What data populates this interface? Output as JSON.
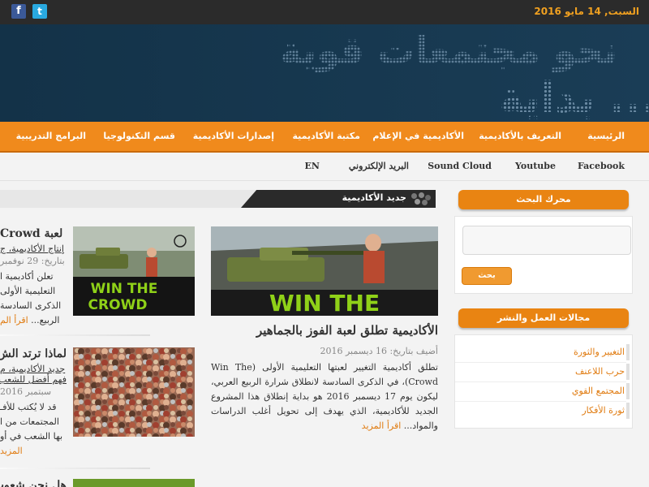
{
  "topbar": {
    "date": "السبت, 14 مايو 2016",
    "facebook_icon": "f",
    "twitter_icon": "t"
  },
  "banner": {
    "line1": "نحو مجتمعات قوية",
    "line2": "ثورة العقول... بداية"
  },
  "main_nav": {
    "items": [
      "الرئيسية",
      "التعريف بالأكاديمية",
      "الأكاديمية في الإعلام",
      "مكتبة الأكاديمية",
      "إصدارات الأكاديمية",
      "قسم التكنولوجيا",
      "البرامج التدريبية"
    ]
  },
  "sub_nav": {
    "items": [
      "Facebook",
      "Youtube",
      "Sound Cloud",
      "البريد الإلكتروني",
      "EN"
    ]
  },
  "section": {
    "title": "جديد الأكاديمية"
  },
  "featured": {
    "image_caption": "WIN THE",
    "title": "الأكاديمية تطلق لعبة الفوز بالجماهير",
    "meta": "أضيف بتاريخ: 16 ديسمبر 2016",
    "excerpt": "تطلق أكاديمية التغيير لعبتها التعليمية الأولى (Win The Crowd)، في الذكرى السادسة لانطلاق شرارة الربيع العربي، ليكون يوم 17 ديسمبر 2016 هو بداية إنطلاق هذا المشروع الجديد للأكاديمية، الذي يهدف إلى تحويل أغلب الدراسات والمواد...",
    "read_more": "اقرأ المزيد"
  },
  "articles": [
    {
      "image_caption_1": "WIN THE",
      "image_caption_2": "CROWD",
      "title": "لعبة Crowd",
      "link": "إنتاج الأكاديمية، ج",
      "meta": "بتاريخ: 29 نوفمبر",
      "lines": [
        "تعلن أكاديمية ا",
        "التعليمية الأولى",
        "الذكرى السادسة",
        "الربيع..."
      ],
      "read_more": "اقرأ الم"
    },
    {
      "title": "لماذا ترتد الش",
      "link": "جديد الأكاديمية، م",
      "link2": "فهم أفضل للشعب",
      "meta": "سبتمبر 2016",
      "lines": [
        "قد لا يُكتب للأفـ",
        "المجتمعات من ا",
        "بها الشعب في أو"
      ],
      "read_more": "المزيد"
    },
    {
      "title": "هل نحن شعوب"
    }
  ],
  "sidebar": {
    "search_title": "محرك البحث",
    "search_placeholder": "",
    "search_button": "بحث",
    "categories_title": "مجالات العمل والنشر",
    "categories": [
      "التغيير والثورة",
      "حرب اللاعنف",
      "المجتمع القوي",
      "ثورة الأفكار"
    ]
  }
}
